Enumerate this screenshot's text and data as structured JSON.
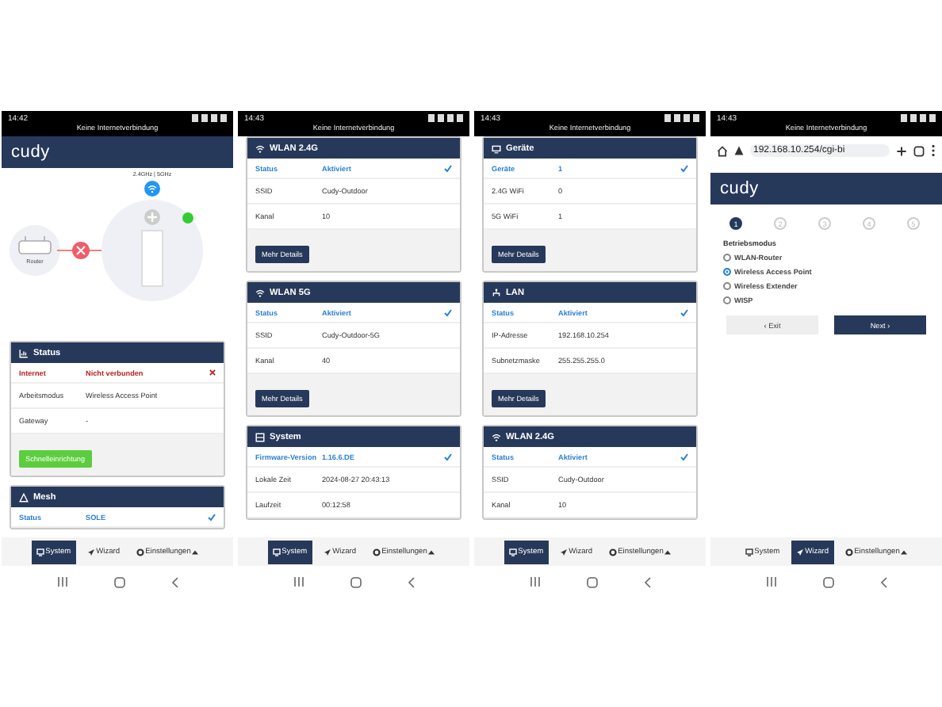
{
  "phones": [
    {
      "status_bar": {
        "time": "14:42",
        "notice": "Keine Internetverbindung"
      },
      "header": {
        "logo": "cudy"
      },
      "diagram": {
        "router_label": "Router",
        "band_label": "2.4GHz | 5GHz",
        "connected": false
      },
      "cards": [
        {
          "title": "Status",
          "kind": "chart",
          "rows": [
            {
              "label": "Internet",
              "value": "Nicht verbunden",
              "kind": "error"
            },
            {
              "label": "Arbeitsmodus",
              "value": "Wireless Access Point",
              "kind": "plain"
            },
            {
              "label": "Gateway",
              "value": "-",
              "kind": "plain"
            }
          ],
          "button": {
            "label": "Schnelleinrichtung",
            "kind": "success"
          }
        },
        {
          "title": "Mesh",
          "kind": "mesh",
          "rows": [
            {
              "label": "Status",
              "value": "SOLE",
              "kind": "ok"
            }
          ]
        }
      ],
      "bottom_nav": [
        {
          "label": "System",
          "selected": true,
          "dropdown": false
        },
        {
          "label": "Wizard",
          "selected": false,
          "dropdown": false
        },
        {
          "label": "Einstellungen",
          "selected": false,
          "dropdown": true
        }
      ]
    },
    {
      "status_bar": {
        "time": "14:43",
        "notice": "Keine Internetverbindung"
      },
      "cards": [
        {
          "title": "WLAN 2.4G",
          "kind": "wifi",
          "rows": [
            {
              "label": "Status",
              "value": "Aktiviert",
              "kind": "ok"
            },
            {
              "label": "SSID",
              "value": "Cudy-Outdoor",
              "kind": "plain"
            },
            {
              "label": "Kanal",
              "value": "10",
              "kind": "plain"
            }
          ],
          "button": {
            "label": "Mehr Details",
            "kind": "primary"
          }
        },
        {
          "title": "WLAN 5G",
          "kind": "wifi",
          "rows": [
            {
              "label": "Status",
              "value": "Aktiviert",
              "kind": "ok"
            },
            {
              "label": "SSID",
              "value": "Cudy-Outdoor-5G",
              "kind": "plain"
            },
            {
              "label": "Kanal",
              "value": "40",
              "kind": "plain"
            }
          ],
          "button": {
            "label": "Mehr Details",
            "kind": "primary"
          }
        },
        {
          "title": "System",
          "kind": "system",
          "rows": [
            {
              "label": "Firmware-Version",
              "value": "1.16.6.DE",
              "kind": "ok"
            },
            {
              "label": "Lokale Zeit",
              "value": "2024-08-27 20:43:13",
              "kind": "plain"
            },
            {
              "label": "Laufzeit",
              "value": "00:12:58",
              "kind": "plain"
            }
          ]
        }
      ],
      "bottom_nav": [
        {
          "label": "System",
          "selected": true,
          "dropdown": false
        },
        {
          "label": "Wizard",
          "selected": false,
          "dropdown": false
        },
        {
          "label": "Einstellungen",
          "selected": false,
          "dropdown": true
        }
      ]
    },
    {
      "status_bar": {
        "time": "14:43",
        "notice": "Keine Internetverbindung"
      },
      "cards": [
        {
          "title": "Geräte",
          "kind": "devices",
          "rows": [
            {
              "label": "Geräte",
              "value": "1",
              "kind": "ok"
            },
            {
              "label": "2.4G WiFi",
              "value": "0",
              "kind": "plain"
            },
            {
              "label": "5G WiFi",
              "value": "1",
              "kind": "plain"
            }
          ],
          "button": {
            "label": "Mehr Details",
            "kind": "primary"
          }
        },
        {
          "title": "LAN",
          "kind": "lan",
          "rows": [
            {
              "label": "Status",
              "value": "Aktiviert",
              "kind": "ok"
            },
            {
              "label": "IP-Adresse",
              "value": "192.168.10.254",
              "kind": "plain"
            },
            {
              "label": "Subnetzmaske",
              "value": "255.255.255.0",
              "kind": "plain"
            }
          ],
          "button": {
            "label": "Mehr Details",
            "kind": "primary"
          }
        },
        {
          "title": "WLAN 2.4G",
          "kind": "wifi",
          "rows": [
            {
              "label": "Status",
              "value": "Aktiviert",
              "kind": "ok"
            },
            {
              "label": "SSID",
              "value": "Cudy-Outdoor",
              "kind": "plain"
            },
            {
              "label": "Kanal",
              "value": "10",
              "kind": "plain"
            }
          ]
        }
      ],
      "bottom_nav": [
        {
          "label": "System",
          "selected": true,
          "dropdown": false
        },
        {
          "label": "Wizard",
          "selected": false,
          "dropdown": false
        },
        {
          "label": "Einstellungen",
          "selected": false,
          "dropdown": true
        }
      ]
    },
    {
      "status_bar": {
        "time": "14:43",
        "notice": "Keine Internetverbindung"
      },
      "browser_bar": {
        "url": "192.168.10.254/cgi-bi"
      },
      "header": {
        "logo": "cudy"
      },
      "wizard": {
        "steps": [
          {
            "label": "1",
            "selected": true
          },
          {
            "label": "2",
            "selected": false
          },
          {
            "label": "3",
            "selected": false
          },
          {
            "label": "4",
            "selected": false
          },
          {
            "label": "5",
            "selected": false
          }
        ],
        "heading": "Betriebsmodus",
        "options": [
          {
            "label": "WLAN-Router",
            "selected": false
          },
          {
            "label": "Wireless Access Point",
            "selected": true
          },
          {
            "label": "Wireless Extender",
            "selected": false
          },
          {
            "label": "WISP",
            "selected": false
          }
        ],
        "back_button": "‹ Exit",
        "next_button": "Next ›"
      },
      "bottom_nav": [
        {
          "label": "System",
          "selected": false,
          "dropdown": false
        },
        {
          "label": "Wizard",
          "selected": true,
          "dropdown": false
        },
        {
          "label": "Einstellungen",
          "selected": false,
          "dropdown": true
        }
      ]
    }
  ]
}
